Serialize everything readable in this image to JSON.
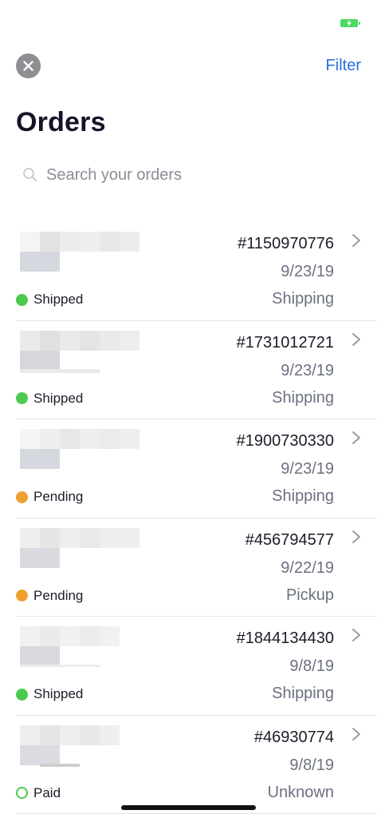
{
  "status_bar": {
    "battery_icon": "battery-charging-icon",
    "battery_color": "#4cd964"
  },
  "header": {
    "close_icon": "close-icon",
    "filter_label": "Filter",
    "title": "Orders"
  },
  "search": {
    "placeholder": "Search your orders",
    "icon": "search-icon"
  },
  "colors": {
    "accent": "#2b6fe0",
    "shipped": "#4cc94f",
    "pending": "#f0a030",
    "paid_outline": "#4cc94f"
  },
  "orders": [
    {
      "number": "#1150970776",
      "date": "9/23/19",
      "method": "Shipping",
      "status": "Shipped",
      "status_kind": "shipped"
    },
    {
      "number": "#1731012721",
      "date": "9/23/19",
      "method": "Shipping",
      "status": "Shipped",
      "status_kind": "shipped"
    },
    {
      "number": "#1900730330",
      "date": "9/23/19",
      "method": "Shipping",
      "status": "Pending",
      "status_kind": "pending"
    },
    {
      "number": "#456794577",
      "date": "9/22/19",
      "method": "Pickup",
      "status": "Pending",
      "status_kind": "pending"
    },
    {
      "number": "#1844134430",
      "date": "9/8/19",
      "method": "Shipping",
      "status": "Shipped",
      "status_kind": "shipped"
    },
    {
      "number": "#46930774",
      "date": "9/8/19",
      "method": "Unknown",
      "status": "Paid",
      "status_kind": "paid"
    }
  ]
}
